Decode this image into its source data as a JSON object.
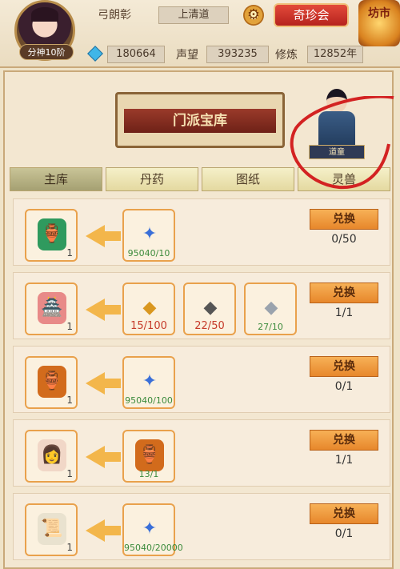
{
  "header": {
    "rank": "分神10阶",
    "name": "弓朗彰",
    "sect": "上清道",
    "shop_button": "奇珍会",
    "market": "坊市",
    "stats": [
      {
        "label": "",
        "value": "180664"
      },
      {
        "label": "声望",
        "value": "393235"
      },
      {
        "label": "修炼",
        "value": "12852年"
      }
    ]
  },
  "panel": {
    "title": "门派宝库",
    "npc_name": "道童",
    "tabs": [
      "主库",
      "丹药",
      "图纸",
      "灵兽"
    ],
    "rows": [
      {
        "reward_qty": "1",
        "costs": [
          {
            "text": "95040/10",
            "status": "ok"
          }
        ],
        "button": "兑换",
        "progress": "0/50"
      },
      {
        "reward_qty": "1",
        "costs": [
          {
            "text": "15/100",
            "status": "bad"
          },
          {
            "text": "22/50",
            "status": "bad"
          },
          {
            "text": "27/10",
            "status": "ok"
          }
        ],
        "button": "兑换",
        "progress": "1/1"
      },
      {
        "reward_qty": "1",
        "costs": [
          {
            "text": "95040/100",
            "status": "ok"
          }
        ],
        "button": "兑换",
        "progress": "0/1"
      },
      {
        "reward_qty": "1",
        "costs": [
          {
            "text": "13/1",
            "status": "ok"
          }
        ],
        "button": "兑换",
        "progress": "1/1"
      },
      {
        "reward_qty": "1",
        "costs": [
          {
            "text": "95040/20000",
            "status": "ok"
          }
        ],
        "button": "兑换",
        "progress": "0/1"
      }
    ]
  },
  "colors": {
    "accent": "#e7872b",
    "bad": "#c63a2a",
    "ok": "#3c8b3c",
    "annotation": "#d32222"
  }
}
